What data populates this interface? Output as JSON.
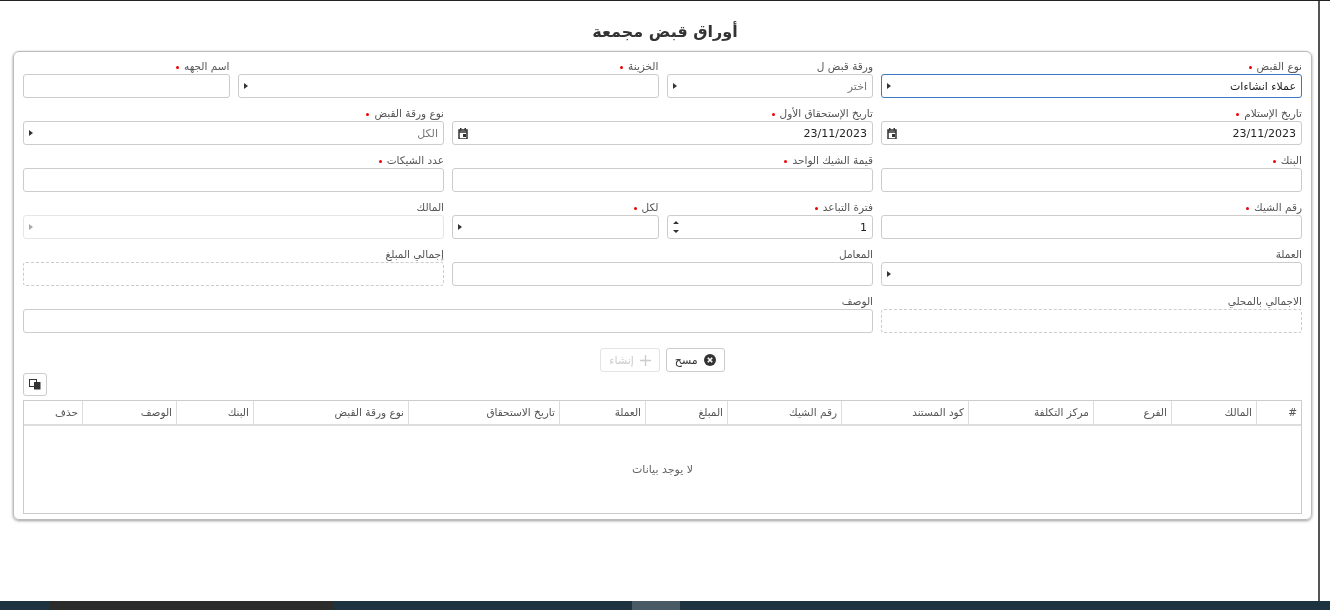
{
  "title": "أوراق قبض مجمعة",
  "rows": [
    [
      {
        "label": "نوع القبض",
        "required": true,
        "kind": "select",
        "value": "عملاء انشاءات",
        "focused": true,
        "disabled": false
      },
      {
        "label": "ورقة قبض ل",
        "required": false,
        "kind": "select",
        "placeholder": "اختر",
        "focused": false,
        "disabled": false
      },
      {
        "label": "الخزينة",
        "required": true,
        "kind": "select",
        "focused": false,
        "disabled": false
      },
      {
        "label": "اسم الجهه",
        "required": true,
        "kind": "text",
        "focused": false,
        "disabled": false
      }
    ],
    [
      {
        "label": "تاريخ الإستلام",
        "required": true,
        "kind": "date",
        "value": "23/11/2023",
        "focused": false,
        "disabled": false
      },
      {
        "label": "تاريخ الإستحقاق الأول",
        "required": true,
        "kind": "date",
        "value": "23/11/2023",
        "focused": false,
        "disabled": false
      },
      {
        "label": "نوع ورقة القبض",
        "required": true,
        "kind": "select",
        "placeholder": "الكل",
        "focused": false,
        "disabled": false
      }
    ],
    [
      {
        "label": "البنك",
        "required": true,
        "kind": "text",
        "focused": false,
        "disabled": false
      },
      {
        "label": "قيمة الشيك الواحد",
        "required": true,
        "kind": "text",
        "focused": false,
        "disabled": false
      },
      {
        "label": "عدد الشيكات",
        "required": true,
        "kind": "text",
        "focused": false,
        "disabled": false
      }
    ],
    [
      {
        "label": "رقم الشيك",
        "required": true,
        "kind": "text",
        "focused": false,
        "disabled": false
      },
      {
        "label": "فترة التباعد",
        "required": true,
        "kind": "number",
        "value": "1",
        "focused": false,
        "disabled": false
      },
      {
        "label": "لكل",
        "required": true,
        "kind": "select",
        "focused": false,
        "disabled": false
      },
      {
        "label": "المالك",
        "required": false,
        "kind": "select",
        "focused": false,
        "disabled": true
      }
    ],
    [
      {
        "label": "العملة",
        "required": false,
        "kind": "select",
        "focused": false,
        "disabled": false
      },
      {
        "label": "المعامل",
        "required": false,
        "kind": "text",
        "focused": false,
        "disabled": false
      },
      {
        "label": "إجمالي المبلغ",
        "required": false,
        "kind": "readonly",
        "focused": false,
        "disabled": false
      }
    ],
    [
      {
        "label": "الاجمالي بالمحلي",
        "required": false,
        "kind": "readonly",
        "focused": false,
        "disabled": false
      },
      {
        "label": "الوصف",
        "required": false,
        "kind": "text",
        "focused": false,
        "disabled": false
      }
    ]
  ],
  "buttons": [
    {
      "label": "مسح",
      "kind": "clear",
      "disabled": false
    },
    {
      "label": "إنشاء",
      "kind": "create",
      "disabled": true
    }
  ],
  "table": {
    "columns": [
      "#",
      "المالك",
      "الفرع",
      "مركز التكلفة",
      "كود المستند",
      "رقم الشيك",
      "المبلغ",
      "العملة",
      "تاريخ الاستحقاق",
      "نوع ورقة القبض",
      "البنك",
      "الوصف",
      "حذف"
    ],
    "empty_message": "لا يوجد بيانات"
  }
}
